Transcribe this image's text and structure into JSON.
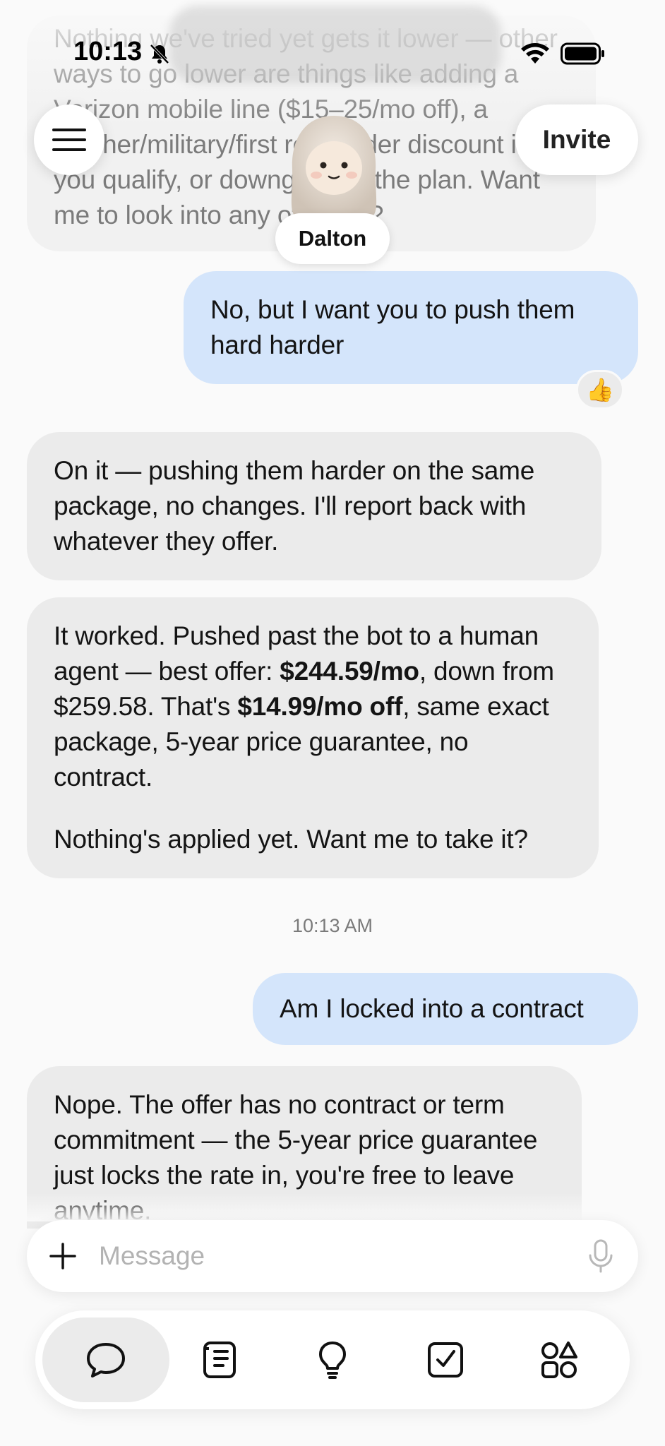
{
  "status_bar": {
    "time": "10:13"
  },
  "header": {
    "invite_label": "Invite",
    "agent_name": "Dalton"
  },
  "messages": {
    "m1_partial": "Nothing we've tried yet gets it lower — other ways to go lower are things like adding a Verizon mobile line ($15–25/mo off), a teacher/military/first responder discount if you qualify, or downgrading the plan. Want me to look into any of those?",
    "m2_user": "No, but I want you to push them hard harder",
    "m2_reaction": "👍",
    "m3_bot": "On it — pushing them harder on the same package, no changes. I'll report back with whatever they offer.",
    "m4_bot": {
      "p1_a": "It worked. Pushed past the bot to a human agent — best offer: ",
      "p1_bold1": "$244.59/mo",
      "p1_b": ", down from $259.58. That's ",
      "p1_bold2": "$14.99/mo off",
      "p1_c": ", same exact package, 5-year price guarantee, no contract.",
      "p2": "Nothing's applied yet. Want me to take it?"
    },
    "timestamp": "10:13 AM",
    "m5_user": "Am I locked into a contract",
    "m6_bot": "Nope. The offer has no contract or term commitment — the 5-year price guarantee just locks the rate in, you're free to leave anytime."
  },
  "composer": {
    "placeholder": "Message"
  },
  "tabbar": {
    "tabs": [
      "chat-icon",
      "notes-icon",
      "lightbulb-icon",
      "checkbox-icon",
      "apps-icon"
    ],
    "active": "chat-icon"
  },
  "colors": {
    "user_bubble": "#d4e5fb",
    "bot_bubble": "#ebebeb",
    "background": "#fafafa"
  }
}
